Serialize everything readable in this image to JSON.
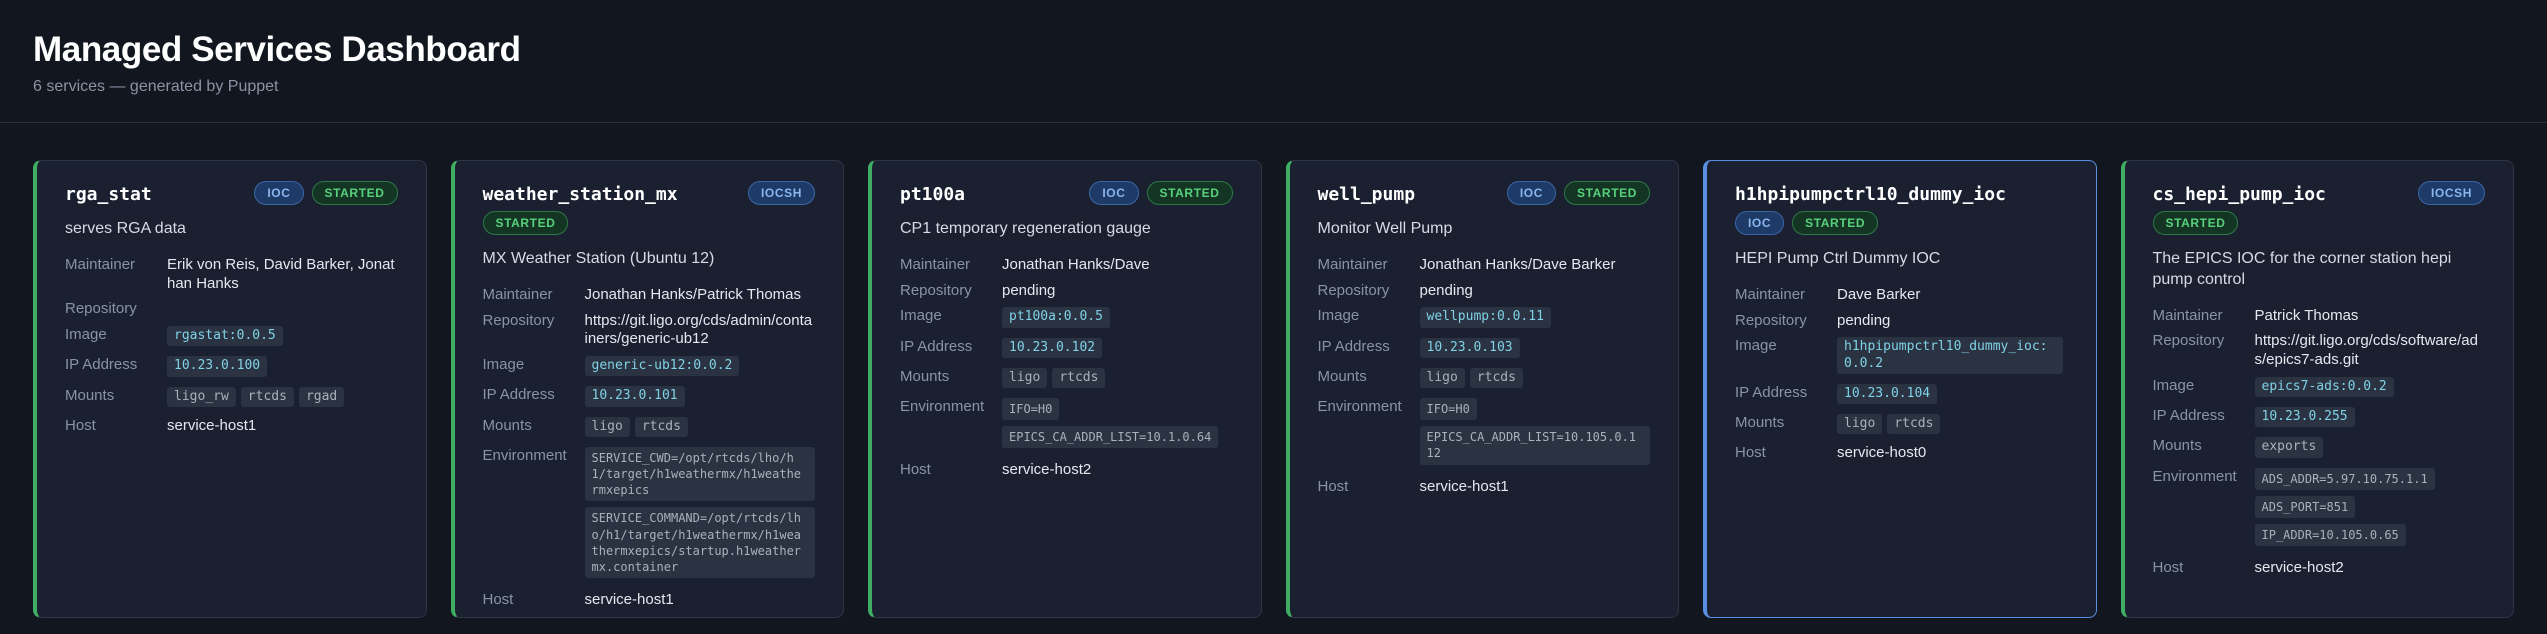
{
  "header": {
    "title": "Managed Services Dashboard",
    "subtitle": "6 services — generated by Puppet"
  },
  "labels": {
    "maintainer": "Maintainer",
    "repository": "Repository",
    "image": "Image",
    "ip": "IP Address",
    "mounts": "Mounts",
    "environment": "Environment",
    "host": "Host"
  },
  "colors": {
    "accent_started": "#3fae63",
    "accent_selected": "#5a8ee0"
  },
  "cards": [
    {
      "name": "rga_stat",
      "type": "IOC",
      "status": "STARTED",
      "description": "serves RGA data",
      "maintainer": "Erik von Reis, David Barker, Jonathan Hanks",
      "repository": "",
      "image": "rgastat:0.0.5",
      "ip": "10.23.0.100",
      "mounts": [
        "ligo_rw",
        "rtcds",
        "rgad"
      ],
      "environment": [],
      "host": "service-host1"
    },
    {
      "name": "weather_station_mx",
      "type": "IOCSH",
      "status": "STARTED",
      "description": "MX Weather Station (Ubuntu 12)",
      "maintainer": "Jonathan Hanks/Patrick Thomas",
      "repository": "https://git.ligo.org/cds/admin/containers/generic-ub12",
      "image": "generic-ub12:0.0.2",
      "ip": "10.23.0.101",
      "mounts": [
        "ligo",
        "rtcds"
      ],
      "environment": [
        "SERVICE_CWD=/opt/rtcds/lho/h1/target/h1weathermx/h1weathermxepics",
        "SERVICE_COMMAND=/opt/rtcds/lho/h1/target/h1weathermx/h1weathermxepics/startup.h1weathermx.container"
      ],
      "host": "service-host1"
    },
    {
      "name": "pt100a",
      "type": "IOC",
      "status": "STARTED",
      "description": "CP1 temporary regeneration gauge",
      "maintainer": "Jonathan Hanks/Dave",
      "repository": "pending",
      "image": "pt100a:0.0.5",
      "ip": "10.23.0.102",
      "mounts": [
        "ligo",
        "rtcds"
      ],
      "environment": [
        "IFO=H0",
        "EPICS_CA_ADDR_LIST=10.1.0.64"
      ],
      "host": "service-host2"
    },
    {
      "name": "well_pump",
      "type": "IOC",
      "status": "STARTED",
      "description": "Monitor Well Pump",
      "maintainer": "Jonathan Hanks/Dave Barker",
      "repository": "pending",
      "image": "wellpump:0.0.11",
      "ip": "10.23.0.103",
      "mounts": [
        "ligo",
        "rtcds"
      ],
      "environment": [
        "IFO=H0",
        "EPICS_CA_ADDR_LIST=10.105.0.112"
      ],
      "host": "service-host1"
    },
    {
      "name": "h1hpipumpctrl10_dummy_ioc",
      "type": "IOC",
      "status": "STARTED",
      "description": "HEPI Pump Ctrl Dummy IOC",
      "maintainer": "Dave Barker",
      "repository": "pending",
      "image": "h1hpipumpctrl10_dummy_ioc:0.0.2",
      "ip": "10.23.0.104",
      "mounts": [
        "ligo",
        "rtcds"
      ],
      "environment": [],
      "host": "service-host0"
    },
    {
      "name": "cs_hepi_pump_ioc",
      "type": "IOCSH",
      "status": "STARTED",
      "description": "The EPICS IOC for the corner station hepi pump control",
      "maintainer": "Patrick Thomas",
      "repository": "https://git.ligo.org/cds/software/ads/epics7-ads.git",
      "image": "epics7-ads:0.0.2",
      "ip": "10.23.0.255",
      "mounts": [
        "exports"
      ],
      "environment": [
        "ADS_ADDR=5.97.10.75.1.1",
        "ADS_PORT=851",
        "IP_ADDR=10.105.0.65"
      ],
      "host": "service-host2"
    }
  ]
}
